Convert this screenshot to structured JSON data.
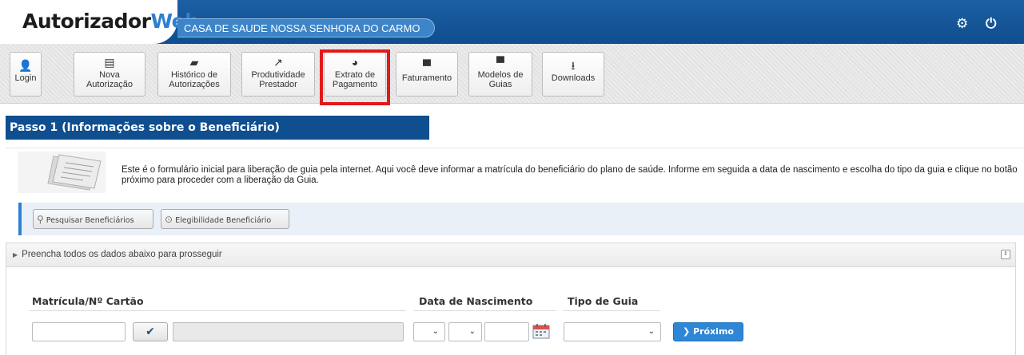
{
  "header": {
    "logo_part1": "Autorizador",
    "logo_part2": "Web",
    "clinic_name": "CASA DE SAUDE NOSSA SENHORA DO CARMO"
  },
  "toolbar": {
    "items": [
      {
        "line1": "Login",
        "line2": "",
        "icon": "user-icon"
      },
      {
        "line1": "Nova",
        "line2": "Autorização",
        "icon": "form-icon"
      },
      {
        "line1": "Histórico de",
        "line2": "Autorizações",
        "icon": "folder-icon"
      },
      {
        "line1": "Produtividade",
        "line2": "Prestador",
        "icon": "line-chart-icon"
      },
      {
        "line1": "Extrato de",
        "line2": "Pagamento",
        "icon": "pie-chart-icon"
      },
      {
        "line1": "Faturamento",
        "line2": "",
        "icon": "archive-icon"
      },
      {
        "line1": "Modelos de",
        "line2": "Guias",
        "icon": "archive-icon"
      },
      {
        "line1": "Downloads",
        "line2": "",
        "icon": "download-icon"
      }
    ]
  },
  "step": {
    "title": "Passo 1 (Informações sobre o Beneficiário)"
  },
  "intro": {
    "text": "Este é o formulário inicial para liberação de guia pela internet. Aqui você deve informar a matrícula do beneficiário do plano de saúde. Informe em seguida a data de nascimento e escolha do tipo da guia e clique no botão próximo para proceder com a liberação da Guia."
  },
  "search": {
    "search_label": "Pesquisar Beneficiários",
    "eligibility_label": "Elegibilidade Beneficiário"
  },
  "form": {
    "panel_title": "Preencha todos os dados abaixo para prosseguir",
    "card_label": "Matrícula/Nº Cartão",
    "birth_label": "Data de Nascimento",
    "guide_type_label": "Tipo de Guia",
    "card_value": "",
    "year_value": "",
    "next_label": "Próximo"
  },
  "colors": {
    "header_blue": "#0f4e8f",
    "accent_blue": "#2e86d6",
    "highlight_red": "#e01b1b"
  }
}
